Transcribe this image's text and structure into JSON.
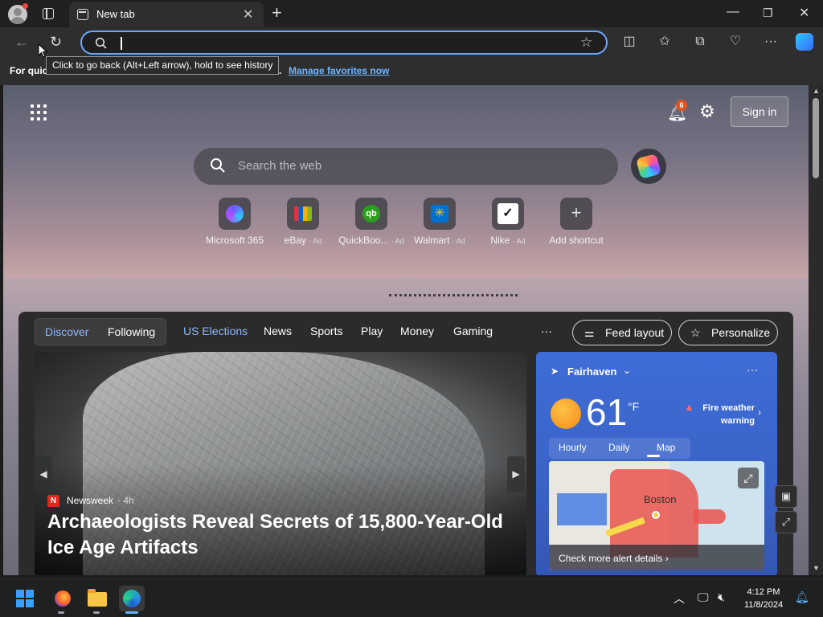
{
  "browser": {
    "tab_title": "New tab",
    "address_value": "",
    "tooltip": "Click to go back (Alt+Left arrow), hold to see history",
    "favorites_label": "For quic",
    "favorites_suffix": ".",
    "favorites_link": "Manage favorites now",
    "window_controls": [
      "minimize-icon",
      "maximize-icon",
      "close-icon"
    ]
  },
  "ntp": {
    "notification_count": "6",
    "sign_in": "Sign in",
    "search_placeholder": "Search the web",
    "shortcuts": [
      {
        "name": "Microsoft 365",
        "ad": "",
        "icon": "microsoft365-icon"
      },
      {
        "name": "eBay",
        "ad": "· Ad",
        "icon": "ebay-icon"
      },
      {
        "name": "QuickBoo...",
        "ad": "· Ad",
        "icon": "quickbooks-icon"
      },
      {
        "name": "Walmart",
        "ad": "· Ad",
        "icon": "walmart-icon"
      },
      {
        "name": "Nike",
        "ad": "· Ad",
        "icon": "nike-icon"
      },
      {
        "name": "Add shortcut",
        "ad": "",
        "icon": "plus-icon"
      }
    ]
  },
  "feed": {
    "toggle": [
      "Discover",
      "Following"
    ],
    "nav": [
      "US Elections",
      "News",
      "Sports",
      "Play",
      "Money",
      "Gaming"
    ],
    "more": "···",
    "feed_layout": "Feed layout",
    "personalize": "Personalize",
    "hero": {
      "source": "Newsweek",
      "age": "· 4h",
      "headline": "Archaeologists Reveal Secrets of 15,800-Year-Old Ice Age Artifacts"
    },
    "weather": {
      "city": "Fairhaven",
      "temp": "61",
      "unit": "°F",
      "warning": "Fire weather warning",
      "tabs": [
        "Hourly",
        "Daily",
        "Map"
      ],
      "active_tab": "Map",
      "map_label": "Boston",
      "alert_link": "Check more alert details"
    }
  },
  "taskbar": {
    "time": "4:12 PM",
    "date": "11/8/2024"
  },
  "colors": {
    "accent": "#6aa8ff",
    "link": "#71b7ff",
    "weather_card": "#3f6cd6",
    "badge": "#e0531f"
  }
}
